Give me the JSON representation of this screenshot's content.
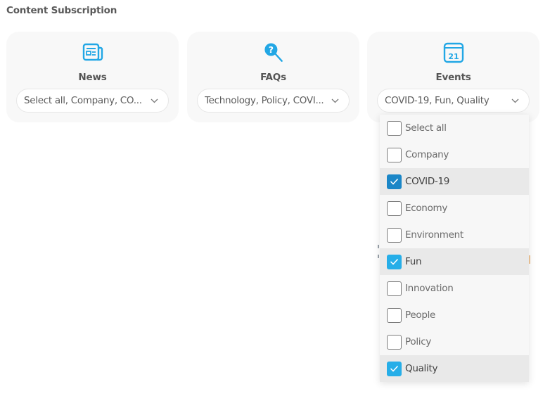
{
  "section_title": "Content Subscription",
  "colors": {
    "accent": "#22a7e5",
    "checkbox_checked_active": "#1a86c7",
    "checkbox_checked": "#26aee8",
    "card_bg": "#f8f8f8"
  },
  "cards": [
    {
      "id": "news",
      "label": "News",
      "icon": "newspaper-icon",
      "selected_value": "Select all, Company, CO..."
    },
    {
      "id": "faqs",
      "label": "FAQs",
      "icon": "question-search-icon",
      "selected_value": "Technology, Policy, COVI..."
    },
    {
      "id": "events",
      "label": "Events",
      "icon": "calendar-icon",
      "icon_text": "21",
      "selected_value": "COVID-19, Fun, Quality",
      "expanded": true
    }
  ],
  "events_dropdown": {
    "options": [
      {
        "label": "Select all",
        "checked": false
      },
      {
        "label": "Company",
        "checked": false
      },
      {
        "label": "COVID-19",
        "checked": true
      },
      {
        "label": "Economy",
        "checked": false
      },
      {
        "label": "Environment",
        "checked": false
      },
      {
        "label": "Fun",
        "checked": true
      },
      {
        "label": "Innovation",
        "checked": false
      },
      {
        "label": "People",
        "checked": false
      },
      {
        "label": "Policy",
        "checked": false
      },
      {
        "label": "Quality",
        "checked": true
      }
    ]
  }
}
